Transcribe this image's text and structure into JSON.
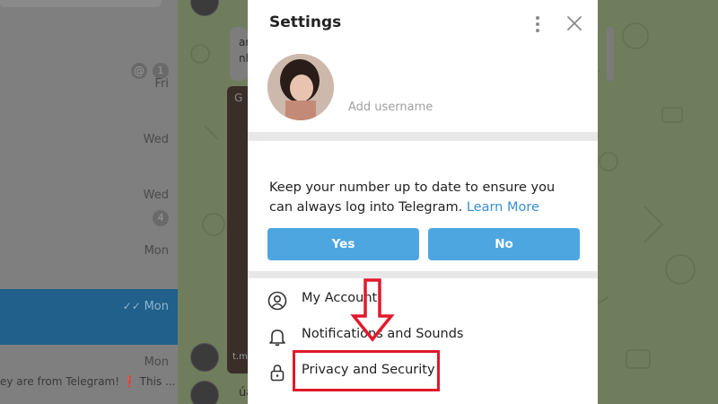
{
  "chat_list": {
    "rows": [
      {
        "time": "",
        "badge": "1",
        "mention": "@",
        "preview": ""
      },
      {
        "time": "Fri",
        "badge": "",
        "mention": "",
        "preview": ""
      },
      {
        "time": "Wed",
        "badge": "",
        "mention": "",
        "preview": ""
      },
      {
        "time": "Wed",
        "badge": "4",
        "mention": "",
        "preview": ""
      },
      {
        "time": "Mon",
        "badge": "",
        "mention": "",
        "preview": ""
      },
      {
        "time": "Mon",
        "badge": "",
        "mention": "",
        "preview": "",
        "selected": true
      },
      {
        "time": "Mon",
        "badge": "",
        "mention": "",
        "preview_text": "ey are from Telegram!",
        "preview_warn": "❗",
        "preview_more": "This ..."
      }
    ]
  },
  "chat_area": {
    "bubble_snippets": [
      "ar",
      "nh",
      "G",
      "t.m",
      "úa"
    ]
  },
  "settings": {
    "title": "Settings",
    "add_username": "Add username",
    "phone_prompt": "Keep your number up to date to ensure you can always log into Telegram.",
    "learn_more": "Learn More",
    "yes_label": "Yes",
    "no_label": "No",
    "menu": [
      {
        "label": "My Account",
        "icon": "account-icon"
      },
      {
        "label": "Notifications and Sounds",
        "icon": "bell-icon"
      },
      {
        "label": "Privacy and Security",
        "icon": "lock-icon"
      }
    ]
  },
  "colors": {
    "accent": "#4ea6e0",
    "link": "#3a8fd0",
    "annotation": "#e0192b",
    "selected_chat": "#20608a"
  }
}
